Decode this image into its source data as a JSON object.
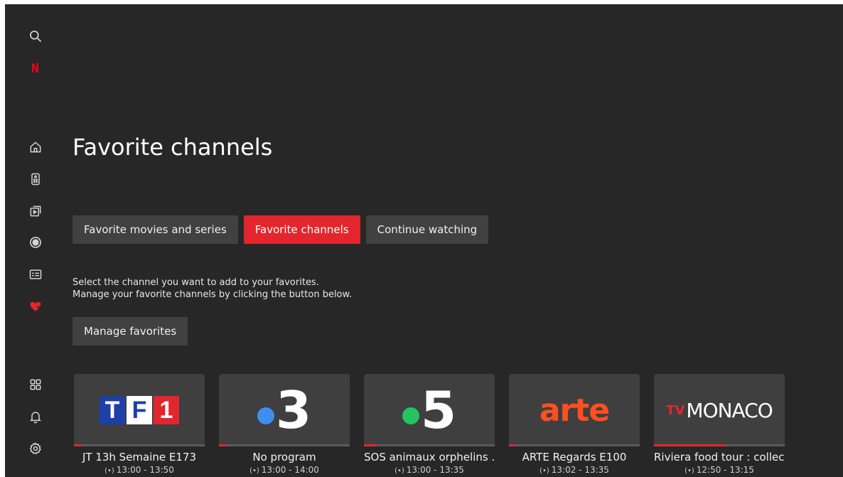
{
  "sidebar": {
    "netflix_letter": "N",
    "items": [
      {
        "icon": "search-icon"
      },
      {
        "icon": "netflix-icon"
      },
      {
        "icon": "home-icon"
      },
      {
        "icon": "remote-icon"
      },
      {
        "icon": "replay-icon"
      },
      {
        "icon": "record-icon"
      },
      {
        "icon": "guide-icon"
      },
      {
        "icon": "heart-icon",
        "active": true
      },
      {
        "icon": "apps-grid-icon"
      },
      {
        "icon": "bell-icon"
      },
      {
        "icon": "settings-gear-icon"
      }
    ]
  },
  "page": {
    "title": "Favorite channels"
  },
  "tabs": [
    {
      "label": "Favorite movies and series",
      "active": false
    },
    {
      "label": "Favorite channels",
      "active": true
    },
    {
      "label": "Continue watching",
      "active": false
    }
  ],
  "description": {
    "line1": "Select the channel you want to add to your favorites.",
    "line2": "Manage your favorite channels by clicking the button below."
  },
  "manage_button": {
    "label": "Manage favorites"
  },
  "channels": [
    {
      "logo_icon": "tf1-logo",
      "logo_parts": [
        "T",
        "F",
        "1"
      ],
      "program": "JT 13h Semaine E173",
      "time": "13:00 - 13:50",
      "progress": 0.06
    },
    {
      "logo_icon": "france3-logo",
      "logo_text": "3",
      "dot_color": "#3d8ef0",
      "program": "No program",
      "time": "13:00 - 14:00",
      "progress": 0.06
    },
    {
      "logo_icon": "france5-logo",
      "logo_text": "5",
      "dot_color": "#22c55e",
      "program": "SOS animaux orphelins ...",
      "time": "13:00 - 13:35",
      "progress": 0.1
    },
    {
      "logo_icon": "arte-logo",
      "logo_text": "arte",
      "program": "ARTE Regards E100",
      "time": "13:02 - 13:35",
      "progress": 0.05
    },
    {
      "logo_icon": "tvmonaco-logo",
      "logo_prefix": "TV",
      "logo_text": "MONACO",
      "program": "Riviera food tour : collec...",
      "time": "12:50 - 13:15",
      "progress": 0.55
    }
  ],
  "colors": {
    "background": "#272727",
    "accent_red": "#e3262d",
    "button_bg": "#414141",
    "card_bg": "#3f3f3f",
    "icon_gray": "#d4d4d4",
    "arte_orange": "#ff4f1f",
    "tf1_blue": "#1c3fa8",
    "tf1_red": "#e3262d"
  }
}
